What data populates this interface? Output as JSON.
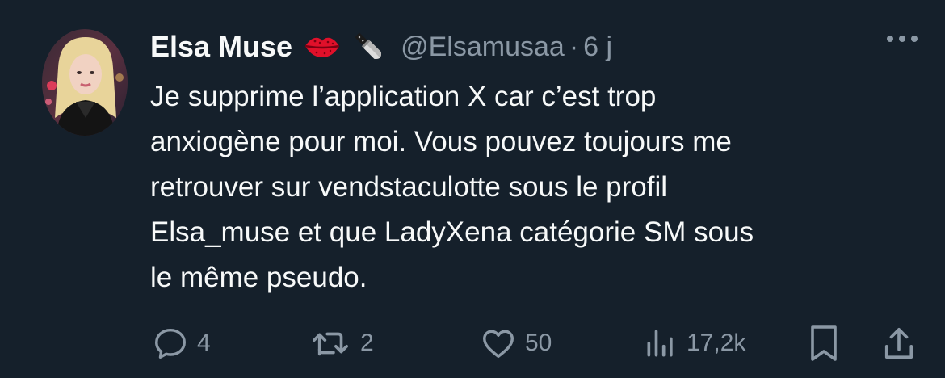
{
  "tweet": {
    "author": {
      "display_name": "Elsa Muse",
      "handle": "@Elsamusaa",
      "emojis": [
        "lips-icon",
        "knife-icon"
      ]
    },
    "separator": "·",
    "timestamp": "6 j",
    "text": "Je supprime l’application X car c’est trop\nanxiogène pour moi. Vous pouvez toujours me\nretrouver sur vendstaculotte sous le profil\nElsa_muse et que LadyXena catégorie SM sous\nle même pseudo."
  },
  "actions": {
    "replies": "4",
    "retweets": "2",
    "likes": "50",
    "views": "17,2k"
  },
  "colors": {
    "background": "#15202b",
    "primary_text": "#f7f9f9",
    "secondary_text": "#8b98a5"
  }
}
